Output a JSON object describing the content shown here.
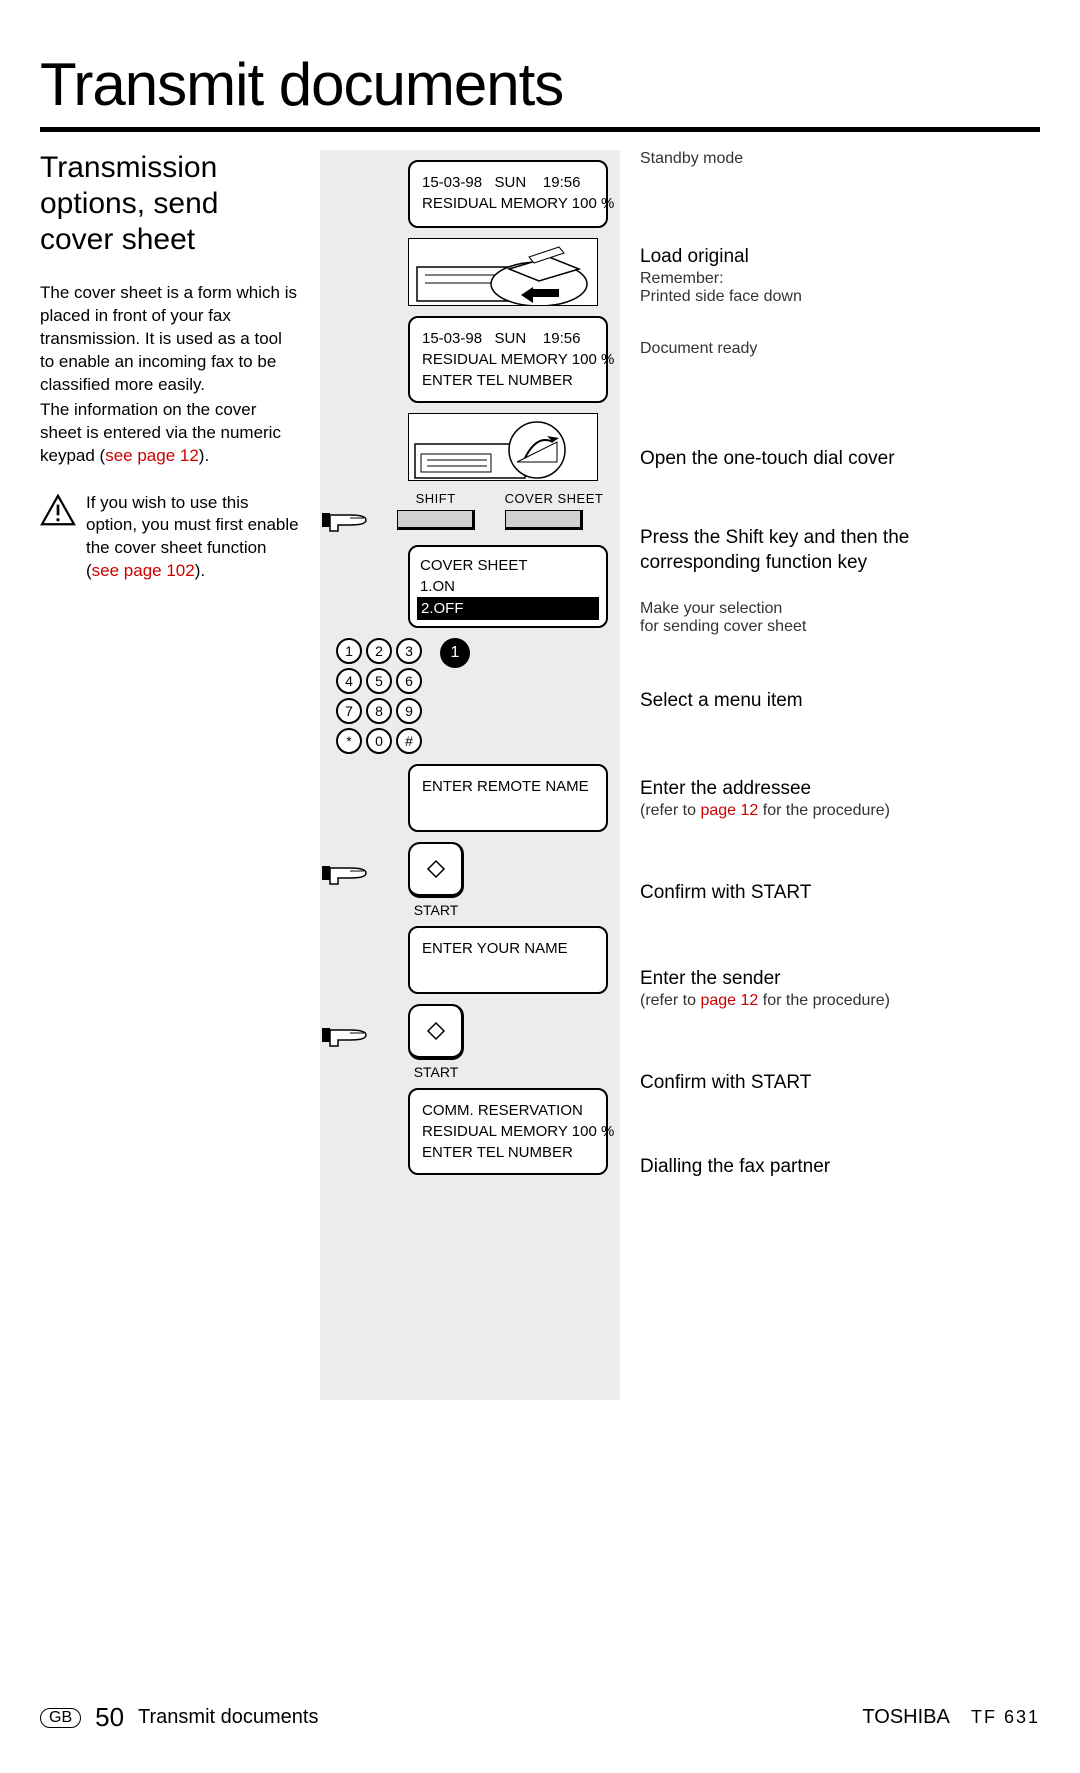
{
  "title": "Transmit documents",
  "subtitle": "Transmission options, send cover sheet",
  "body1": "The cover sheet is a form which is placed in front of your fax transmission. It is used as a tool to enable an incoming fax to be classified more easily.",
  "body2": "The information on the cover sheet is entered via the numeric keypad (",
  "body2_link": "see page 12",
  "body2_end": ").",
  "note": "If you wish to use this option, you must first enable the cover sheet function (",
  "note_link": "see page 102",
  "note_end": ").",
  "lcd1": {
    "l1": "15-03-98   SUN    19:56",
    "l2": "",
    "l3": "RESIDUAL MEMORY 100 %"
  },
  "lcd2": {
    "l1": "15-03-98   SUN    19:56",
    "l2": "",
    "l3": "RESIDUAL MEMORY 100 %",
    "l4": "ENTER TEL NUMBER"
  },
  "keys": {
    "shift": "SHIFT",
    "cover": "COVER SHEET"
  },
  "lcd3": {
    "l1": "COVER SHEET",
    "l2": "1.ON",
    "l3": "2.OFF"
  },
  "keypad": [
    "1",
    "2",
    "3",
    "4",
    "5",
    "6",
    "7",
    "8",
    "9",
    "*",
    "0",
    "#"
  ],
  "keypad_sel": "1",
  "lcd4": {
    "l1": "ENTER REMOTE NAME"
  },
  "start": "START",
  "lcd5": {
    "l1": "ENTER YOUR NAME"
  },
  "lcd6": {
    "l1": "COMM. RESERVATION",
    "l2": "",
    "l3": "RESIDUAL MEMORY 100 %",
    "l4": "ENTER TEL NUMBER"
  },
  "r0": "Standby mode",
  "r1": {
    "h": "Load original",
    "s1": "Remember:",
    "s2": "Printed side face down"
  },
  "r2": "Document ready",
  "r3": "Open the one-touch dial cover",
  "r4": "Press the Shift key and then the corresponding function key",
  "r5": {
    "s1": "Make your selection",
    "s2": "for sending cover sheet"
  },
  "r6": "Select a menu item",
  "r7": {
    "h": "Enter the addressee",
    "pre": "(refer to ",
    "link": "page 12",
    "post": " for the procedure)"
  },
  "r8": "Confirm with START",
  "r9": {
    "h": "Enter the sender",
    "pre": "(refer to ",
    "link": "page 12",
    "post": " for the procedure)"
  },
  "r10": "Confirm with START",
  "r11": "Dialling the fax partner",
  "footer": {
    "lang": "GB",
    "page": "50",
    "section": "Transmit documents",
    "brand": "TOSHIBA",
    "model": "TF 631"
  }
}
